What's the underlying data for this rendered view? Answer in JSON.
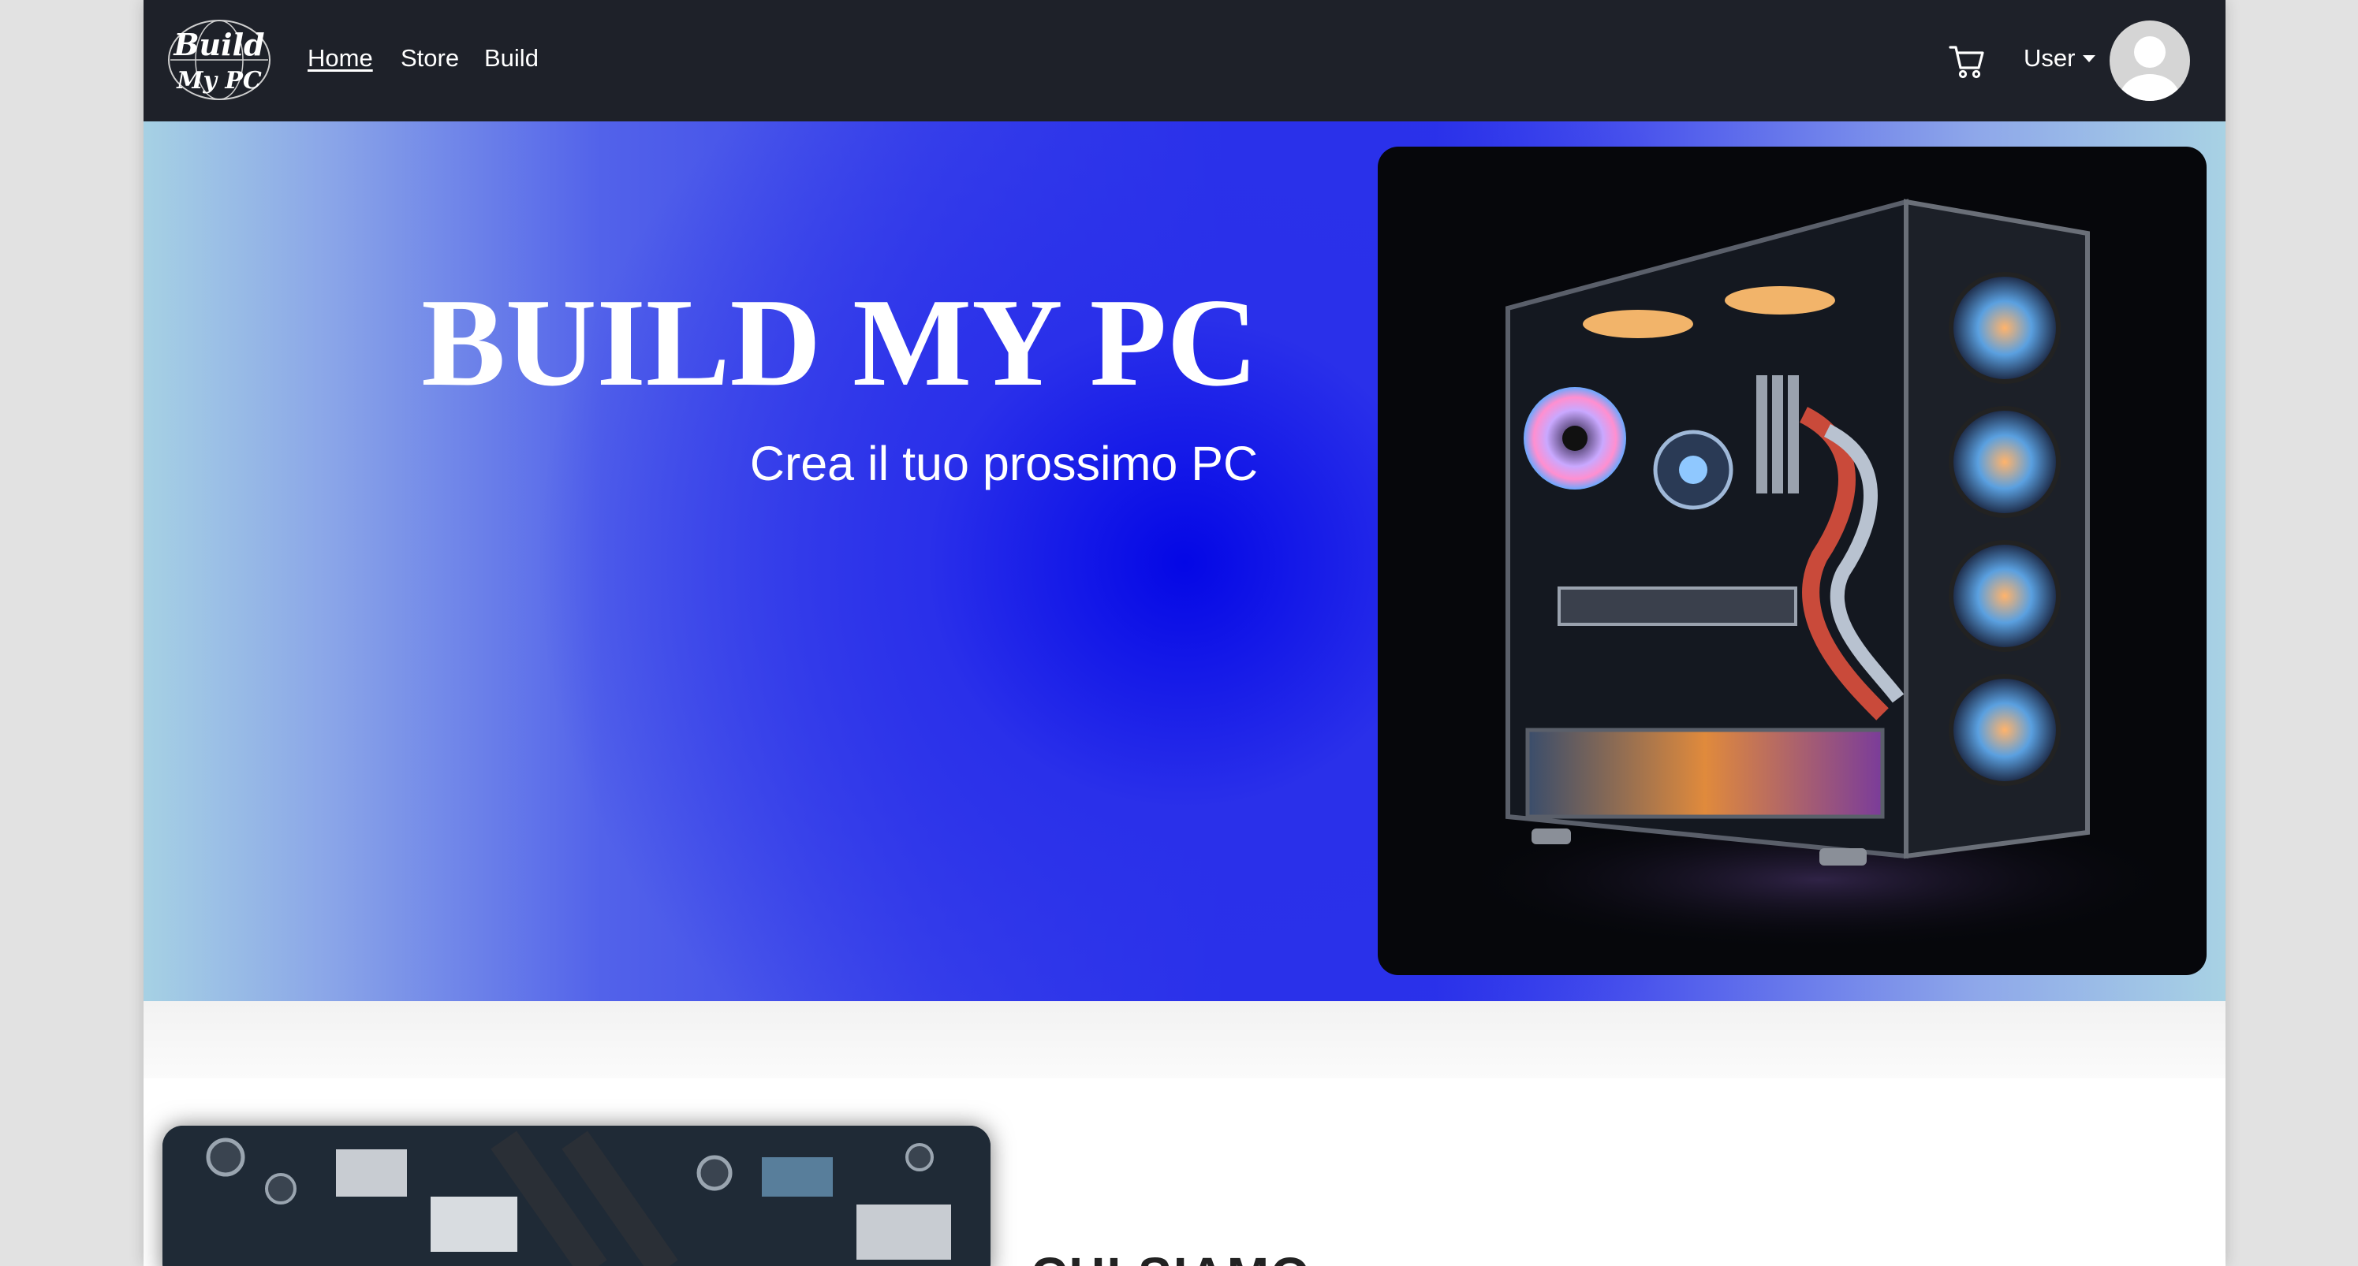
{
  "brand": {
    "logo_text": "Build My PC"
  },
  "nav": {
    "home": "Home",
    "store": "Store",
    "build": "Build"
  },
  "user_menu": {
    "label": "User"
  },
  "hero": {
    "title": "BUILD MY PC",
    "subtitle": "Crea il tuo prossimo PC"
  },
  "section": {
    "heading": "CHI SIAMO"
  },
  "icons": {
    "cart": "cart-icon",
    "avatar": "user-avatar-icon",
    "caret": "caret-down-icon"
  },
  "colors": {
    "navbar": "#1e2129",
    "hero_blue": "#0407e6",
    "hero_edge": "#a8d2e4"
  }
}
